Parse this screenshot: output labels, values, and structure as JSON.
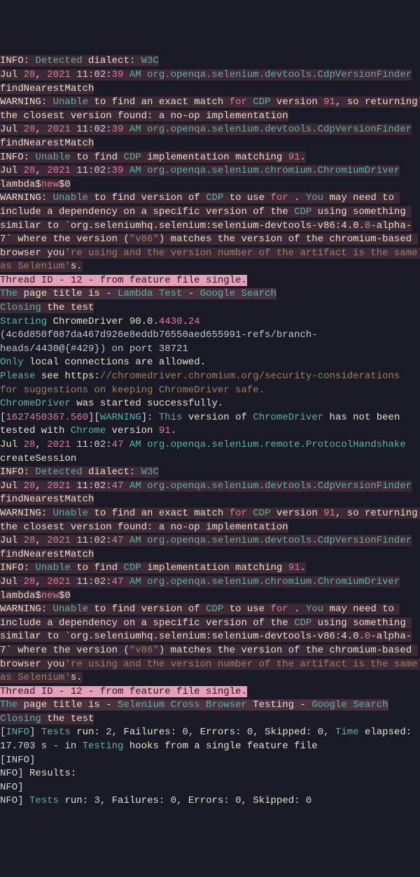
{
  "block1": {
    "l1_a": "INFO:",
    "l1_b": "Detected",
    "l1_c": "dialect:",
    "l1_d": "W3C",
    "l2_a": "Jul ",
    "l2_b": "28",
    "l2_c": ", ",
    "l2_d": "2021",
    "l2_e": " 11:02:",
    "l2_f": "39",
    "l2_g": " AM ",
    "l2_h": "org.openqa.selenium.devtools.CdpVersionFinder",
    "l3": "findNearestMatch",
    "l4_a": "WARNING:",
    "l4_b": "Unable",
    "l4_c": " to find an exact match ",
    "l4_d": "for",
    "l4_e": "CDP",
    "l4_f": " version ",
    "l4_g": "91",
    "l4_h": ", so returning the closest version ",
    "l4_i": "found:",
    "l4_j": " a no-op implementation",
    "l5_a": "Jul ",
    "l5_b": "28",
    "l5_c": ", ",
    "l5_d": "2021",
    "l5_e": " 11:02:",
    "l5_f": "39",
    "l5_g": " AM ",
    "l5_h": "org.openqa.selenium.devtools.CdpVersionFinder",
    "l6": "findNearestMatch",
    "l7_a": "INFO:",
    "l7_b": "Unable",
    "l7_c": " to find ",
    "l7_d": "CDP",
    "l7_e": " implementation matching ",
    "l7_f": "91",
    "l7_g": ".",
    "l8_a": "Jul ",
    "l8_b": "28",
    "l8_c": ", ",
    "l8_d": "2021",
    "l8_e": " 11:02:",
    "l8_f": "39",
    "l8_g": " AM ",
    "l8_h": "org.openqa.selenium.chromium.ChromiumDriver",
    "l9_a": "lambda$",
    "l9_b": "new",
    "l9_c": "$0",
    "l10_a": "WARNING:",
    "l10_b": "Unable",
    "l10_c": " to find version of ",
    "l10_d": "CDP",
    "l10_e": " to use ",
    "l10_f": "for",
    "l10_g": " . ",
    "l10_h": "You",
    "l10_i": " may need to include a dependency on a specific version of the ",
    "l10_j": "CDP",
    "l10_k": " using something similar to `",
    "l10_l": "org.seleniumhq.selenium:",
    "l10_m": "selenium-devtools-v86:4.0",
    "l10_n": ".",
    "l10_o": "0",
    "l10_p": "-alpha-7` where the version (",
    "l10_q": "\"v86\"",
    "l10_r": ") matches the version of the chromium-based browser you",
    "l10_s": "'re using and the version number of the artifact is the same as Selenium'",
    "l10_t": "s.",
    "l11": "Thread ID - 12 - from feature file single.",
    "l12_a": "The",
    "l12_b": " page title is - ",
    "l12_c": "Lambda Test",
    "l12_d": " - ",
    "l12_e": "Google Search",
    "l13_a": "Closing",
    "l13_b": " the test"
  },
  "start": {
    "l1_a": "Starting",
    "l1_b": " ChromeDriver ",
    "l1_c": "90.0",
    "l1_d": ".",
    "l1_e": "4430",
    "l1_f": ".",
    "l1_g": "24",
    "l2": "(4c6d850f087da467d926e8eddb76550aed655991-refs/branch-heads/4430@{#429}) on port 38721",
    "l3_a": "Only",
    "l3_b": " local connections are allowed.",
    "l4_a": "Please",
    "l4_b": " see ",
    "l4_c": "https:",
    "l4_d": "//chromedriver.chromium.org/security-considerations for suggestions on keeping ChromeDriver safe.",
    "l5_a": "ChromeDriver",
    "l5_b": " was started successfully.",
    "l6_a": "[",
    "l6_b": "1627450367.560",
    "l6_c": "][",
    "l6_d": "WARNING",
    "l6_e": "]: ",
    "l6_f": "This",
    "l6_g": " version of ",
    "l6_h": "ChromeDriver",
    "l6_i": " has not been tested with ",
    "l6_j": "Chrome",
    "l6_k": " version ",
    "l6_l": "91",
    "l6_m": ".",
    "l7_a": "Jul ",
    "l7_b": "28",
    "l7_c": ", ",
    "l7_d": "2021",
    "l7_e": " 11:02:",
    "l7_f": "47",
    "l7_g": " AM ",
    "l7_h": "org.openqa.selenium.remote.ProtocolHandshake",
    "l8": "createSession"
  },
  "block2": {
    "l1_a": "INFO:",
    "l1_b": "Detected",
    "l1_c": "dialect:",
    "l1_d": "W3C",
    "l2_a": "Jul ",
    "l2_b": "28",
    "l2_c": ", ",
    "l2_d": "2021",
    "l2_e": " 11:02:",
    "l2_f": "47",
    "l2_g": " AM ",
    "l2_h": "org.openqa.selenium.devtools.CdpVersionFinder",
    "l3": "findNearestMatch",
    "l4_a": "WARNING:",
    "l4_b": "Unable",
    "l4_c": " to find an exact match ",
    "l4_d": "for",
    "l4_e": "CDP",
    "l4_f": " version ",
    "l4_g": "91",
    "l4_h": ", so returning the closest version ",
    "l4_i": "found:",
    "l4_j": " a no-op implementation",
    "l5_a": "Jul ",
    "l5_b": "28",
    "l5_c": ", ",
    "l5_d": "2021",
    "l5_e": " 11:02:",
    "l5_f": "47",
    "l5_g": " AM ",
    "l5_h": "org.openqa.selenium.devtools.CdpVersionFinder",
    "l6": "findNearestMatch",
    "l7_a": "INFO:",
    "l7_b": "Unable",
    "l7_c": " to find ",
    "l7_d": "CDP",
    "l7_e": " implementation matching ",
    "l7_f": "91",
    "l7_g": ".",
    "l8_a": "Jul ",
    "l8_b": "28",
    "l8_c": ", ",
    "l8_d": "2021",
    "l8_e": " 11:02:",
    "l8_f": "47",
    "l8_g": " AM ",
    "l8_h": "org.openqa.selenium.chromium.ChromiumDriver",
    "l9_a": "lambda$",
    "l9_b": "new",
    "l9_c": "$0",
    "l10_a": "WARNING:",
    "l10_b": "Unable",
    "l10_c": " to find version of ",
    "l10_d": "CDP",
    "l10_e": " to use ",
    "l10_f": "for",
    "l10_g": " . ",
    "l10_h": "You",
    "l10_i": " may need to include a dependency on a specific version of the ",
    "l10_j": "CDP",
    "l10_k": " using something similar to `",
    "l10_l": "org.seleniumhq.selenium:",
    "l10_m": "selenium-devtools-v86:4.0",
    "l10_n": ".",
    "l10_o": "0",
    "l10_p": "-alpha-7` where the version (",
    "l10_q": "\"v86\"",
    "l10_r": ") matches the version of the chromium-based browser you",
    "l10_s": "'re using and the version number of the artifact is the same as Selenium'",
    "l10_t": "s.",
    "l11": "Thread ID - 12 - from feature file single.",
    "l12_a": "The",
    "l12_b": " page title is - ",
    "l12_c": "Selenium Cross Browser",
    "l12_d": " Testing - ",
    "l12_e": "Google Search",
    "l13_a": "Closing",
    "l13_b": " the test"
  },
  "footer": {
    "l1_a": "[",
    "l1_b": "INFO",
    "l1_c": "] ",
    "l1_d": "Tests",
    "l1_e": "run:",
    "l1_f": " 2, ",
    "l1_g": "Failures:",
    "l1_h": " 0, ",
    "l1_i": "Errors:",
    "l1_j": " 0, ",
    "l1_k": "Skipped:",
    "l1_l": " 0, ",
    "l1_m": "Time",
    "l1_n": "elapsed:",
    "l1_o": " 17.703 s - in ",
    "l1_p": "Testing",
    "l1_q": " hooks from a single feature file",
    "l2": "[INFO]",
    "l3_a": "NFO] ",
    "l3_b": "Results:",
    "l4": "NFO]",
    "l5_a": "NFO] ",
    "l5_b": "Tests",
    "l5_c": "run:",
    "l5_d": " 3, ",
    "l5_e": "Failures:",
    "l5_f": " 0, ",
    "l5_g": "Errors:",
    "l5_h": " 0, ",
    "l5_i": "Skipped:",
    "l5_j": " 0"
  }
}
